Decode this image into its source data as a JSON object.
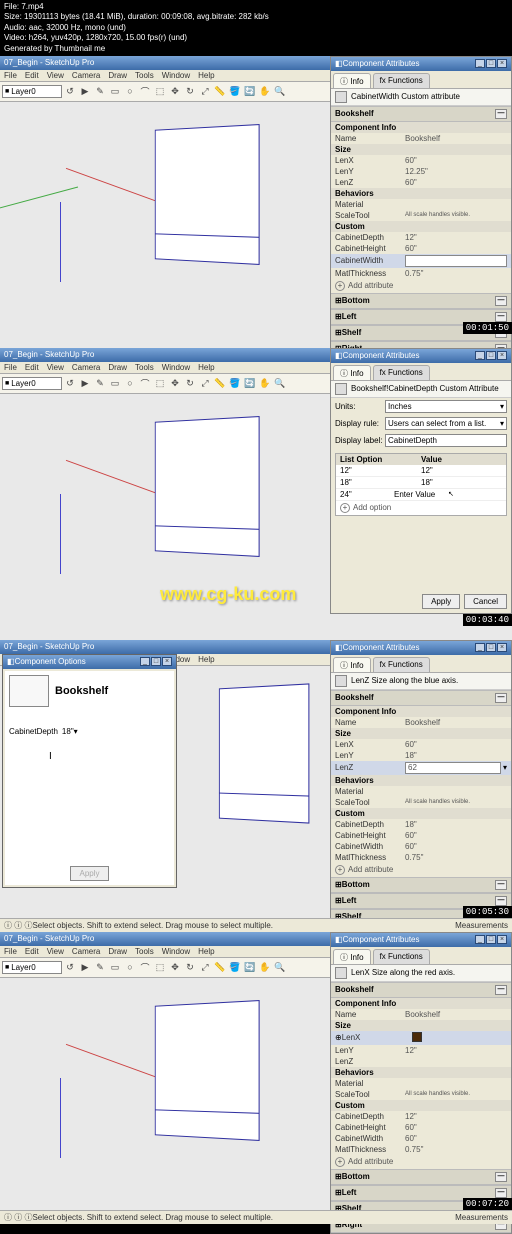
{
  "header": {
    "file": "File: 7.mp4",
    "size": "Size: 19301113 bytes (18.41 MiB), duration: 00:09:08, avg.bitrate: 282 kb/s",
    "audio": "Audio: aac, 32000 Hz, mono (und)",
    "video": "Video: h264, yuv420p, 1280x720, 15.00 fps(r) (und)",
    "gen": "Generated by Thumbnail me"
  },
  "app_title": "07_Begin - SketchUp Pro",
  "menus": [
    "File",
    "Edit",
    "View",
    "Camera",
    "Draw",
    "Tools",
    "Window",
    "Help"
  ],
  "layer": "Layer0",
  "panel_title": "Component Attributes",
  "tab_info": "Info",
  "tab_func": "Functions",
  "crumb1": "CabinetWidth  Custom attribute",
  "crumb2": "Bookshelf!CabinetDepth  Custom Attribute",
  "crumb3": "LenZ  Size along the blue axis.",
  "crumb4": "LenX  Size along the red axis.",
  "bookshelf": "Bookshelf",
  "comp_info": "Component Info",
  "name": "Name",
  "name_v": "Bookshelf",
  "size": "Size",
  "lenx": "LenX",
  "lenx_v1": "60\"",
  "leny": "LenY",
  "leny_v1": "12.25\"",
  "leny_v4": "12\"",
  "lenz": "LenZ",
  "lenz_v1": "60\"",
  "lenz_v3": "18\"",
  "lenz_v3b": "62",
  "behaviors": "Behaviors",
  "material": "Material",
  "scaletool": "ScaleTool",
  "scale_v": "All scale handles visible.",
  "custom": "Custom",
  "cab_depth": "CabinetDepth",
  "cab_depth_v": "12\"",
  "cab_depth_v3": "18\"",
  "cab_height": "CabinetHeight",
  "cab_height_v": "60\"",
  "cab_width": "CabinetWidth",
  "cab_width_v3": "60\"",
  "matl_thick": "MatlThickness",
  "matl_v": "0.75\"",
  "add_attr": "Add attribute",
  "bottom": "Bottom",
  "left": "Left",
  "shelf": "Shelf",
  "right": "Right",
  "units_lbl": "Units:",
  "units_v": "Inches",
  "disp_rule_lbl": "Display rule:",
  "disp_rule_v": "Users can select from a list.",
  "disp_label_lbl": "Display label:",
  "disp_label_v": "CabinetDepth",
  "list_opt": "List Option",
  "value": "Value",
  "opts": [
    [
      "12\"",
      "12\""
    ],
    [
      "18\"",
      "18\""
    ],
    [
      "24\"",
      "Enter Value"
    ]
  ],
  "add_opt": "Add option",
  "apply": "Apply",
  "cancel": "Cancel",
  "comp_opt_title": "Component Options",
  "comp_opt_field": "CabinetDepth",
  "comp_opt_val": "18\"",
  "status_txt": "Select objects. Shift to extend select. Drag mouse to select multiple.",
  "meas": "Measurements",
  "times": [
    "00:01:50",
    "00:03:40",
    "00:05:30",
    "00:07:20"
  ],
  "watermark": "www.cg-ku.com"
}
